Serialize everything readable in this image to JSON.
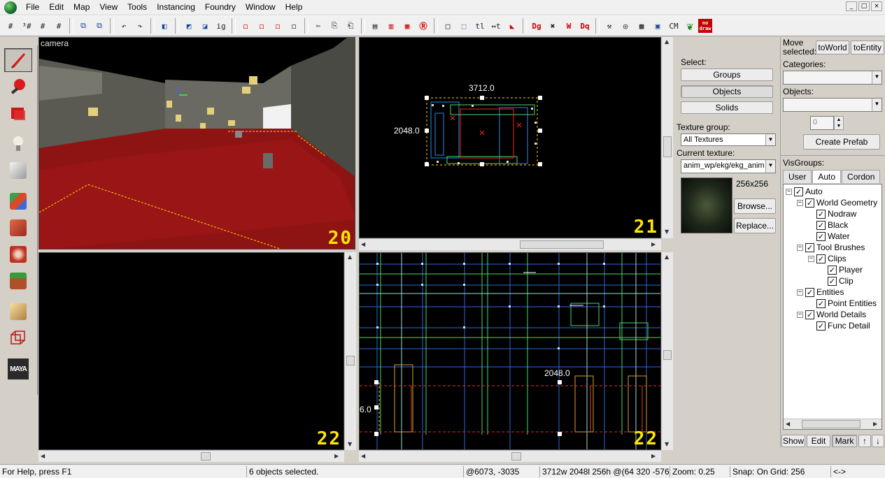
{
  "menu": [
    "File",
    "Edit",
    "Map",
    "View",
    "Tools",
    "Instancing",
    "Foundry",
    "Window",
    "Help"
  ],
  "window_buttons": [
    "_",
    "□",
    "×"
  ],
  "toolbar": {
    "buttons": [
      "#",
      "³#",
      "#",
      "#",
      "⧉",
      "⧉",
      "↶",
      "↷",
      "◧",
      "◩",
      "◪",
      "ig",
      "◻",
      "◻",
      "◻",
      "◻",
      "✂",
      "⎘",
      "⎗",
      "▤",
      "▥",
      "▦",
      "Ⓡ",
      "□",
      "⬚",
      "tl",
      "↔t",
      "◣",
      "Dg",
      "✖",
      "W",
      "Dq",
      "⚒",
      "◎",
      "▩",
      "▣",
      "CM"
    ],
    "nodraw_label": "no draw"
  },
  "viewports": {
    "camera": {
      "label": "camera",
      "number": "20"
    },
    "top": {
      "number": "21",
      "dim_width": "3712.0",
      "dim_height": "2048.0"
    },
    "front": {
      "number": "22"
    },
    "side": {
      "number": "22",
      "dim_width": "2048.0",
      "dim_height": "6.0"
    }
  },
  "texture_panel": {
    "select_label": "Select:",
    "groups": "Groups",
    "objects": "Objects",
    "solids": "Solids",
    "texture_group_label": "Texture group:",
    "texture_group_value": "All Textures",
    "current_texture_label": "Current texture:",
    "current_texture_value": "anim_wp/ekg/ekg_anim",
    "texture_size": "256x256",
    "browse": "Browse...",
    "replace": "Replace..."
  },
  "right_panel": {
    "move_selected": "Move selected:",
    "to_world": "toWorld",
    "to_entity": "toEntity",
    "categories_label": "Categories:",
    "objects_label": "Objects:",
    "spinner_value": "0",
    "create_prefab": "Create Prefab",
    "visgroups_label": "VisGroups:",
    "tabs": [
      "User",
      "Auto",
      "Cordon"
    ],
    "tree": [
      {
        "label": "Auto",
        "level": 0,
        "toggle": "−",
        "checked": true
      },
      {
        "label": "World Geometry",
        "level": 1,
        "toggle": "−",
        "checked": true
      },
      {
        "label": "Nodraw",
        "level": 2,
        "toggle": "",
        "checked": true
      },
      {
        "label": "Black",
        "level": 2,
        "toggle": "",
        "checked": true
      },
      {
        "label": "Water",
        "level": 2,
        "toggle": "",
        "checked": true
      },
      {
        "label": "Tool Brushes",
        "level": 1,
        "toggle": "−",
        "checked": true
      },
      {
        "label": "Clips",
        "level": 2,
        "toggle": "−",
        "checked": true
      },
      {
        "label": "Player",
        "level": 3,
        "toggle": "",
        "checked": true
      },
      {
        "label": "Clip",
        "level": 3,
        "toggle": "",
        "checked": true
      },
      {
        "label": "Entities",
        "level": 1,
        "toggle": "−",
        "checked": true
      },
      {
        "label": "Point Entities",
        "level": 2,
        "toggle": "",
        "checked": true
      },
      {
        "label": "World Details",
        "level": 1,
        "toggle": "−",
        "checked": true
      },
      {
        "label": "Func Detail",
        "level": 2,
        "toggle": "",
        "checked": true
      }
    ],
    "show": "Show",
    "edit": "Edit",
    "mark": "Mark",
    "up": "↑",
    "down": "↓"
  },
  "status": {
    "help": "For Help, press F1",
    "selection": "6 objects selected.",
    "coords": "@6073, -3035",
    "dims": "3712w 2048l 256h @(64 320 -576)",
    "zoom": "Zoom: 0.25",
    "snap": "Snap: On Grid: 256",
    "extra": "<->"
  },
  "colors": {
    "viewport_bg": "#000000",
    "selection": "#ff0000",
    "vp_number": "#ffe600",
    "floor_red": "#8e1414"
  }
}
